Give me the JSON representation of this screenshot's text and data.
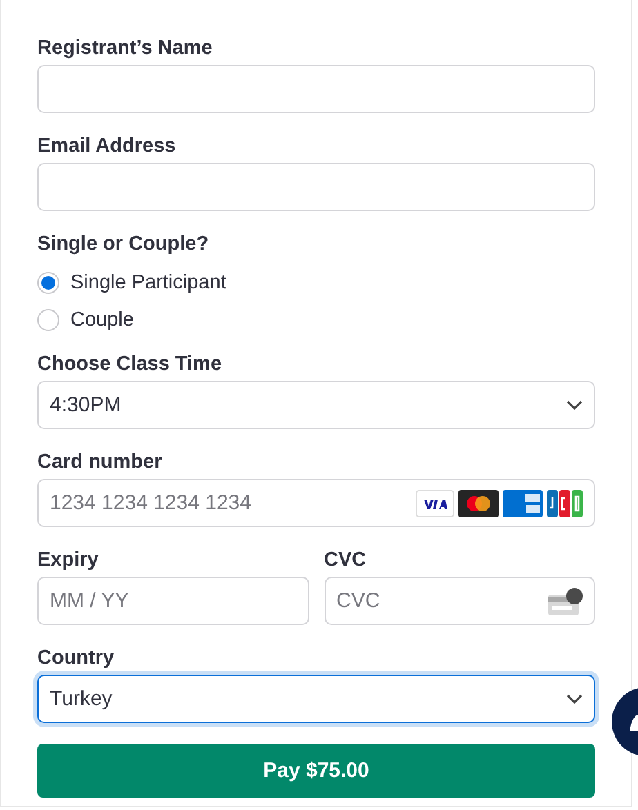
{
  "fields": [
    {
      "kind": "text",
      "label": "Registrant’s Name"
    },
    {
      "kind": "text",
      "label": "Email Address"
    },
    {
      "kind": "radio",
      "label": "Single or Couple?",
      "options": [
        {
          "label": "Single Participant",
          "selected": true
        },
        {
          "label": "Couple",
          "selected": false
        }
      ]
    },
    {
      "kind": "select",
      "label": "Choose Class Time",
      "value": "4:30PM",
      "focused": false
    },
    {
      "kind": "card",
      "label": "Card number",
      "placeholder": "1234 1234 1234 1234"
    },
    {
      "kind": "pair",
      "items": [
        {
          "kind": "text",
          "label": "Expiry",
          "placeholder": "MM / YY"
        },
        {
          "kind": "cvc",
          "label": "CVC",
          "placeholder": "CVC"
        }
      ]
    },
    {
      "kind": "select",
      "label": "Country",
      "value": "Turkey",
      "focused": true
    }
  ],
  "pay_button": {
    "label": "Pay $75.00"
  }
}
